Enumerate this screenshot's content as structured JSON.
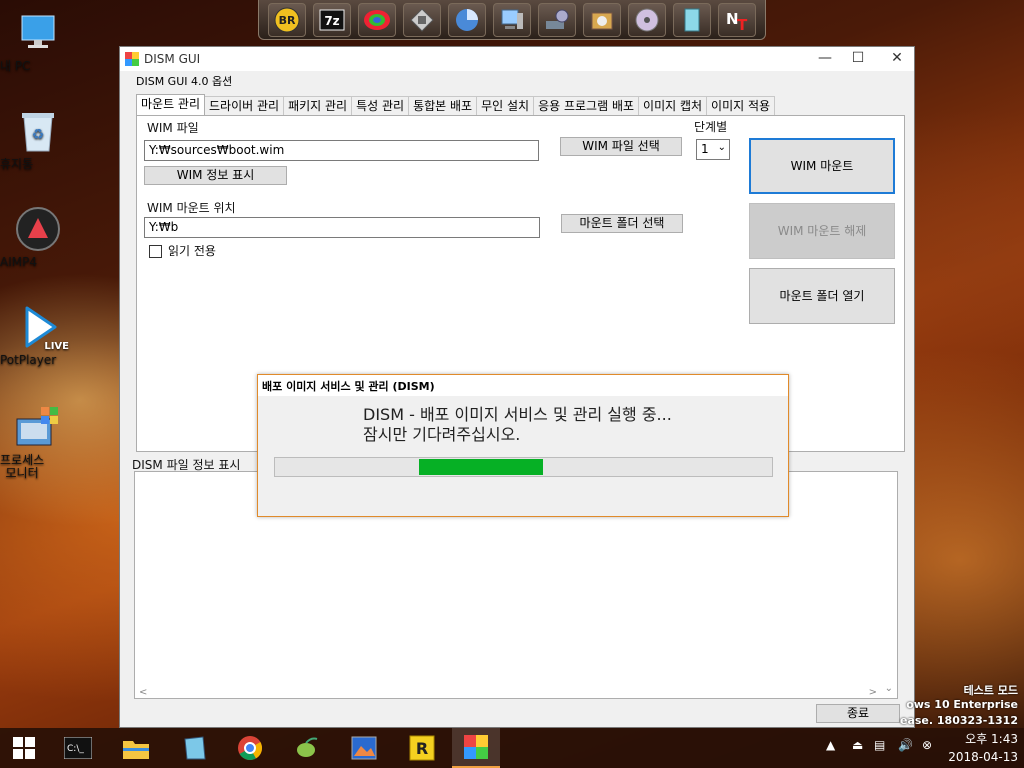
{
  "desktop": {
    "icons": [
      {
        "name": "this-pc",
        "label": "내 PC"
      },
      {
        "name": "recycle-bin",
        "label": "휴지통"
      },
      {
        "name": "aimp4",
        "label": "AIMP4"
      },
      {
        "name": "potplayer",
        "label": "PotPlayer"
      },
      {
        "name": "process-monitor",
        "label": "프로세스\n모니터"
      }
    ],
    "potplayer_badge": "LIVE"
  },
  "launcher": {
    "br_text": "BR",
    "sevenzip_text": "7z"
  },
  "window": {
    "title": "DISM GUI",
    "menu": "DISM GUI 4.0 옵션",
    "tabs": [
      "마운트 관리",
      "드라이버 관리",
      "패키지 관리",
      "특성 관리",
      "통합본 배포",
      "무인 설치",
      "응용 프로그램 배포",
      "이미지 캡처",
      "이미지 적용"
    ],
    "wim_file_label": "WIM 파일",
    "wim_file_value": "Y:₩sources₩boot.wim",
    "select_wim_button": "WIM 파일 선택",
    "stage_label": "단계별",
    "stage_value": "1",
    "wim_info_button": "WIM 정보 표시",
    "mount_location_label": "WIM 마운트 위치",
    "mount_location_value": "Y:₩b",
    "select_mount_folder_button": "마운트 폴더 선택",
    "readonly_label": "읽기 전용",
    "readonly_checked": false,
    "mount_button": "WIM 마운트",
    "unmount_button": "WIM 마운트 해제",
    "open_mount_folder_button": "마운트 폴더 열기",
    "info_section_label": "DISM 파일 정보 표시",
    "close_button": "종료"
  },
  "dialog": {
    "title": "배포 이미지 서비스 및 관리 (DISM)",
    "message_line1": "DISM - 배포 이미지 서비스 및 관리 실행 중...",
    "message_line2": "잠시만 기다려주십시오.",
    "progress_start": 0.29,
    "progress_end": 0.54,
    "progress_color": "#06b025"
  },
  "watermark": {
    "line1": "테스트 모드",
    "line2": "ows 10 Enterprise",
    "line3": "ease. 180323-1312"
  },
  "taskbar": {
    "time": "오후 1:43",
    "date": "2018-04-13",
    "accent": "#f0a040"
  }
}
